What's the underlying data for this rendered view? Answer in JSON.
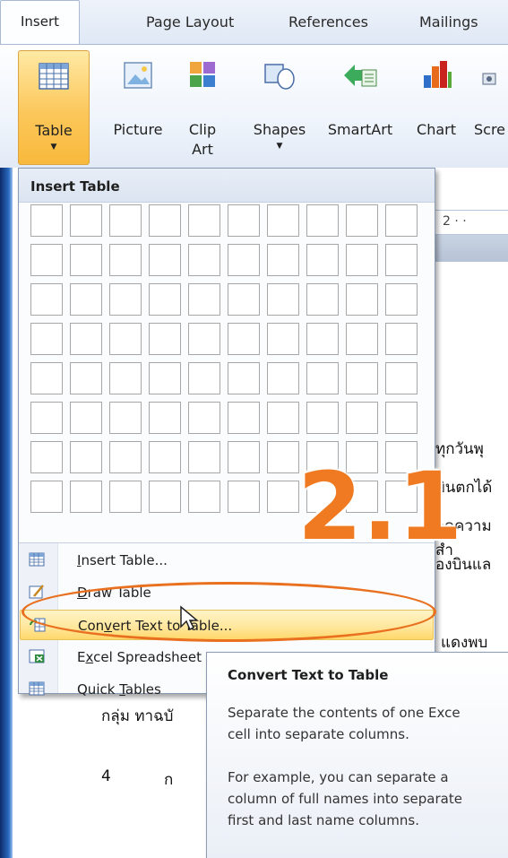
{
  "ribbon": {
    "tabs": [
      "Insert",
      "Page Layout",
      "References",
      "Mailings"
    ],
    "active_tab": "Insert",
    "buttons": [
      {
        "label": "Table",
        "icon": "table-icon",
        "dropdown": true
      },
      {
        "label": "Picture",
        "icon": "picture-icon"
      },
      {
        "label": "Clip\nArt",
        "icon": "clip-art-icon"
      },
      {
        "label": "Shapes",
        "icon": "shapes-icon",
        "dropdown": true
      },
      {
        "label": "SmartArt",
        "icon": "smartart-icon"
      },
      {
        "label": "Chart",
        "icon": "chart-icon"
      },
      {
        "label": "Scre",
        "icon": "screenshot-icon"
      }
    ]
  },
  "dropdown": {
    "header": "Insert Table",
    "grid": {
      "columns": 10,
      "rows": 8
    },
    "items": [
      {
        "label": "Insert Table...",
        "access_key": "I",
        "icon": "insert-table-icon"
      },
      {
        "label": "Draw Table",
        "access_key": "D",
        "icon": "draw-table-icon"
      },
      {
        "label": "Convert Text to Table...",
        "access_key": "v",
        "icon": "convert-text-icon",
        "highlighted": true
      },
      {
        "label": "Excel Spreadsheet",
        "access_key": "x",
        "icon": "excel-icon"
      },
      {
        "label": "Quick Tables",
        "access_key": "T",
        "icon": "quick-tables-icon"
      }
    ]
  },
  "annotation": {
    "step": "2.1",
    "color": "#ef7a21"
  },
  "tooltip": {
    "title": "Convert Text to Table",
    "line1": "Separate the contents of one Exce",
    "line2": "cell into separate columns.",
    "line3": "For example, you can separate a",
    "line4": "column of full names into separate",
    "line5": "first and last name columns."
  },
  "document": {
    "ruler_text": "2 · ·",
    "fragments": [
      "ทุกวันพุ",
      "บินตกได้",
      "จดความสำ",
      "องบินแล",
      "แดงพบ",
      "กลุ่ม ทาฉบั",
      "4",
      "ก"
    ]
  },
  "colors": {
    "accent": "#ef7a21",
    "highlight": "#ffe69a",
    "ribbon_blue": "#dfe8f5"
  }
}
